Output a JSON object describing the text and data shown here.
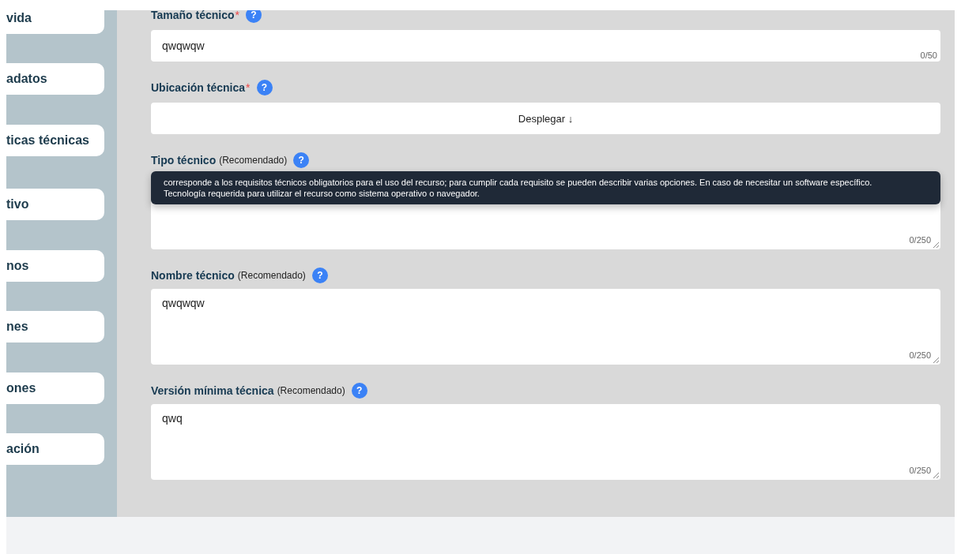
{
  "sidebar": {
    "items": [
      {
        "label": "vida"
      },
      {
        "label": "adatos"
      },
      {
        "label": "ticas técnicas"
      },
      {
        "label": "tivo"
      },
      {
        "label": "nos"
      },
      {
        "label": "nes"
      },
      {
        "label": "ones"
      },
      {
        "label": "ación"
      }
    ]
  },
  "fields": [
    {
      "kind": "input",
      "label": "Tamaño técnico",
      "required_mark": "*",
      "help": "?",
      "value": "qwqwqw",
      "counter": "0/50"
    },
    {
      "kind": "dropdown",
      "label": "Ubicación técnica",
      "required_mark": "*",
      "help": "?",
      "button": "Desplegar ↓"
    },
    {
      "kind": "textarea",
      "label": "Tipo técnico",
      "note": "(Recomendado)",
      "help": "?",
      "counter": "0/250",
      "tooltip": "corresponde a los requisitos técnicos obligatorios para el uso del recurso; para cumplir cada requisito se pueden describir varias opciones. En caso de necesitar un software específico. Tecnología requerida para utilizar el recurso como sistema operativo o navegador."
    },
    {
      "kind": "textarea",
      "label": "Nombre técnico",
      "note": "(Recomendado)",
      "help": "?",
      "value": "qwqwqw",
      "counter": "0/250"
    },
    {
      "kind": "textarea",
      "label": "Versión mínima técnica",
      "note": "(Recomendado)",
      "help": "?",
      "value": "qwq",
      "counter": "0/250"
    }
  ]
}
